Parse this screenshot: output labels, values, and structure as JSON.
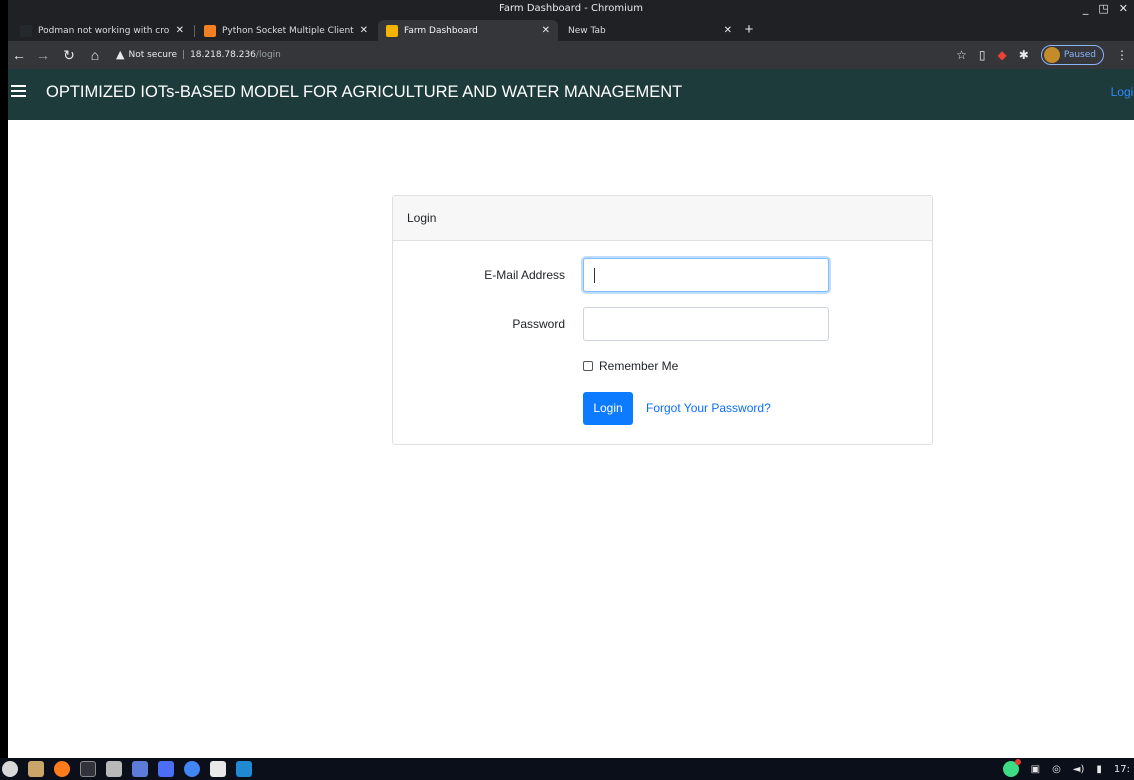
{
  "browser": {
    "window_title": "Farm Dashboard - Chromium",
    "tabs": [
      {
        "title": "Podman not working with cron · Issu",
        "active": false
      },
      {
        "title": "Python Socket Multiple Clients - Sta",
        "active": false
      },
      {
        "title": "Farm Dashboard",
        "active": true
      },
      {
        "title": "New Tab",
        "active": false
      }
    ],
    "security_label": "Not secure",
    "url_host": "18.218.78.236",
    "url_path": "/login",
    "profile_status": "Paused"
  },
  "app": {
    "title": "OPTIMIZED IOTs-BASED MODEL FOR AGRICULTURE AND WATER MANAGEMENT",
    "nav_login": "Login"
  },
  "login_form": {
    "header": "Login",
    "email_label": "E-Mail Address",
    "email_value": "",
    "password_label": "Password",
    "password_value": "",
    "remember_label": "Remember Me",
    "remember_checked": false,
    "submit_label": "Login",
    "forgot_label": "Forgot Your Password?"
  },
  "taskbar": {
    "clock": "17:"
  },
  "colors": {
    "appbar": "#1e3b3b",
    "primary": "#0d7bff",
    "link": "#0d6efd"
  }
}
